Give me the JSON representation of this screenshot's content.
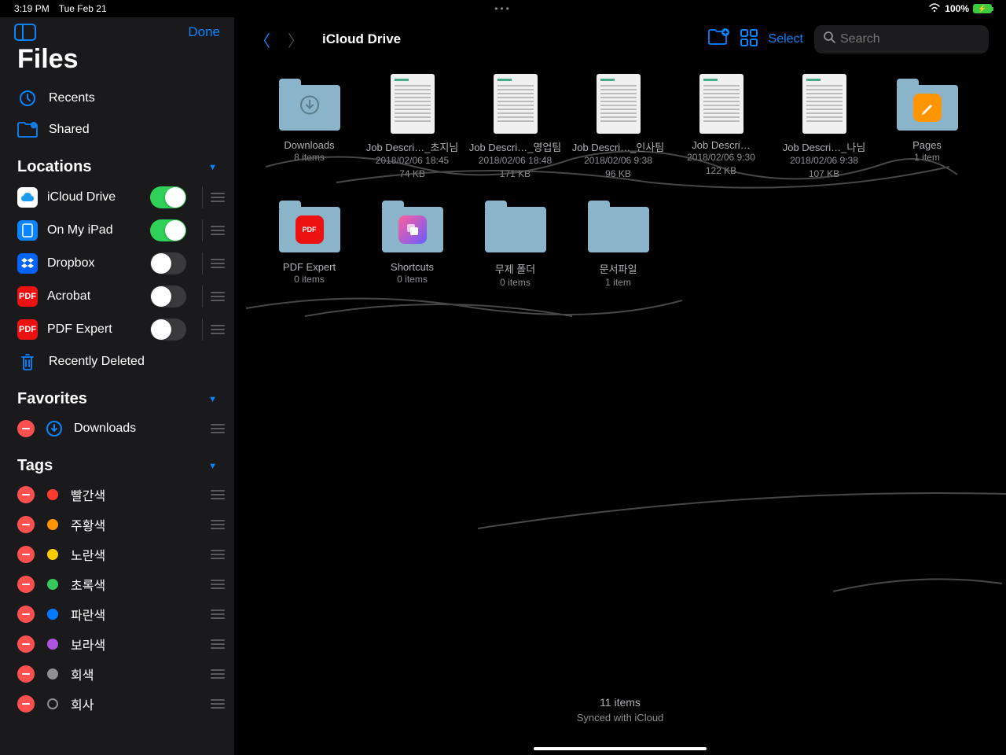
{
  "status": {
    "time": "3:19 PM",
    "date": "Tue Feb 21",
    "battery": "100%"
  },
  "sidebar": {
    "done": "Done",
    "title": "Files",
    "recents": "Recents",
    "shared": "Shared",
    "locations_header": "Locations",
    "locations": [
      {
        "label": "iCloud Drive",
        "on": true,
        "bg": "#fff",
        "fg": "#1d9bf0"
      },
      {
        "label": "On My iPad",
        "on": true,
        "bg": "#0a84ff",
        "fg": "#fff"
      },
      {
        "label": "Dropbox",
        "on": false,
        "bg": "#0062ff",
        "fg": "#fff"
      },
      {
        "label": "Acrobat",
        "on": false,
        "bg": "#e11",
        "fg": "#fff"
      },
      {
        "label": "PDF Expert",
        "on": false,
        "bg": "#e11",
        "fg": "#fff"
      }
    ],
    "recently_deleted": "Recently Deleted",
    "favorites_header": "Favorites",
    "favorites": [
      {
        "label": "Downloads"
      }
    ],
    "tags_header": "Tags",
    "tags": [
      {
        "label": "빨간색",
        "color": "#ff3b30"
      },
      {
        "label": "주황색",
        "color": "#ff9500"
      },
      {
        "label": "노란색",
        "color": "#ffcc00"
      },
      {
        "label": "초록색",
        "color": "#34c759"
      },
      {
        "label": "파란색",
        "color": "#007aff"
      },
      {
        "label": "보라색",
        "color": "#af52de"
      },
      {
        "label": "회색",
        "color": "#8e8e93"
      },
      {
        "label": "회사",
        "color": "transparent",
        "border": "#8e8e93"
      }
    ]
  },
  "main": {
    "path_title": "iCloud Drive",
    "select": "Select",
    "search_placeholder": "Search",
    "items": [
      {
        "type": "folder",
        "name": "Downloads",
        "meta": "8 items",
        "icon": "download"
      },
      {
        "type": "doc",
        "name": "Job Descri…_초지님",
        "meta": "2018/02/06 18:45\n74 KB"
      },
      {
        "type": "doc",
        "name": "Job Descri…_영업팀",
        "meta": "2018/02/06 18:48\n171 KB"
      },
      {
        "type": "doc",
        "name": "Job Descri…_인사팀",
        "meta": "2018/02/06 9:38\n96 KB"
      },
      {
        "type": "doc",
        "name": "Job Descri…",
        "meta": "2018/02/06 9:30\n122 KB"
      },
      {
        "type": "doc",
        "name": "Job Descri…_나님",
        "meta": "2018/02/06 9:38\n107 KB"
      },
      {
        "type": "folder",
        "name": "Pages",
        "meta": "1 item",
        "icon": "pages"
      },
      {
        "type": "folder",
        "name": "PDF Expert",
        "meta": "0 items",
        "icon": "pdfexpert"
      },
      {
        "type": "folder",
        "name": "Shortcuts",
        "meta": "0 items",
        "icon": "shortcuts"
      },
      {
        "type": "folder",
        "name": "무제 폴더",
        "meta": "0 items"
      },
      {
        "type": "folder",
        "name": "문서파일",
        "meta": "1 item"
      }
    ],
    "footer_count": "11 items",
    "footer_sync": "Synced with iCloud"
  }
}
